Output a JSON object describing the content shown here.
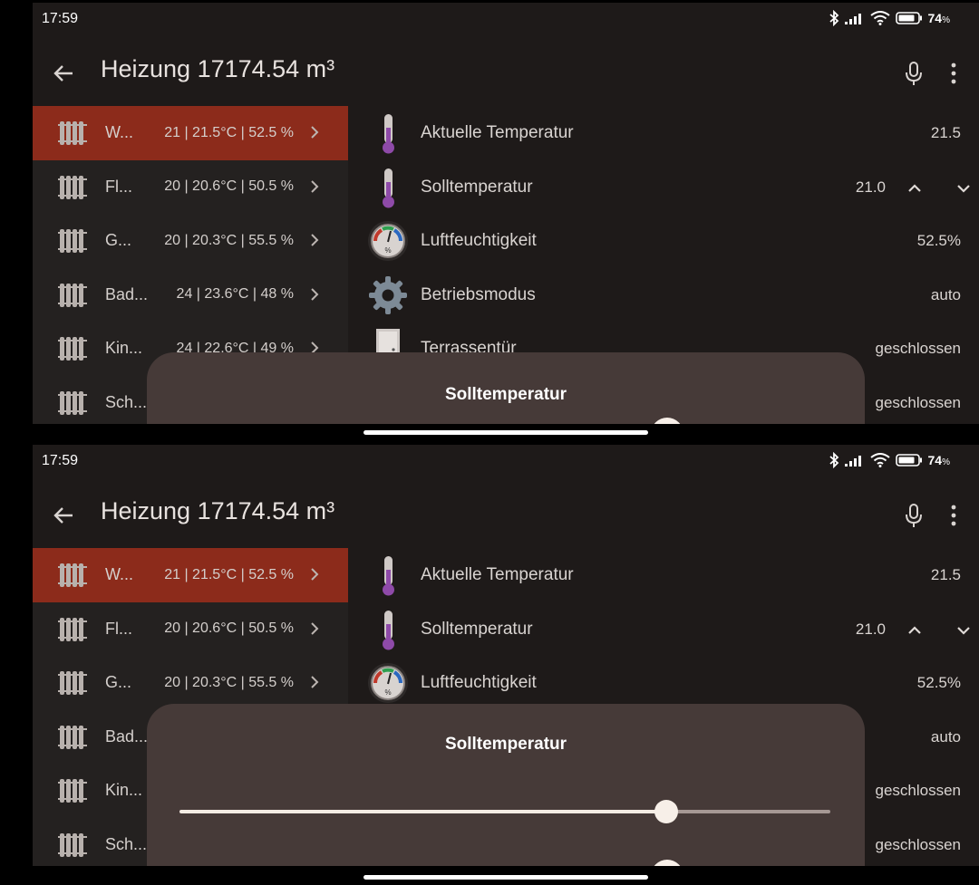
{
  "status": {
    "time": "17:59",
    "battery": "74"
  },
  "appbar": {
    "title": "Heizung 17174.54 m³"
  },
  "rooms": [
    {
      "name": "W...",
      "value": "21 | 21.5°C | 52.5 %",
      "selected": true
    },
    {
      "name": "Fl...",
      "value": "20 | 20.6°C | 50.5 %",
      "selected": false
    },
    {
      "name": "G...",
      "value": "20 | 20.3°C | 55.5 %",
      "selected": false
    },
    {
      "name": "Bad...",
      "value": "24 | 23.6°C | 48 %",
      "selected": false
    },
    {
      "name": "Kin...",
      "value": "24 | 22.6°C | 49 %",
      "selected": false
    },
    {
      "name": "Sch...",
      "value": "",
      "selected": false
    }
  ],
  "details": [
    {
      "label": "Aktuelle Temperatur",
      "value": "21.5",
      "icon": "thermometer-icon"
    },
    {
      "label": "Solltemperatur",
      "value": "21.0",
      "icon": "thermometer-icon",
      "stepper": true
    },
    {
      "label": "Luftfeuchtigkeit",
      "value": "52.5%",
      "icon": "hygrometer-icon"
    },
    {
      "label": "Betriebsmodus",
      "value": "auto",
      "icon": "gear-icon"
    },
    {
      "label": "Terrassentür",
      "value": "geschlossen",
      "icon": "door-icon"
    },
    {
      "label": "",
      "value": "geschlossen",
      "icon": ""
    }
  ],
  "sheet": {
    "title": "Solltemperatur"
  },
  "slider": {
    "fraction": 0.748
  },
  "colors": {
    "selected_row": "#8c2b1b",
    "sheet": "#463a38",
    "thermo_fill": "#8e4aa8"
  }
}
